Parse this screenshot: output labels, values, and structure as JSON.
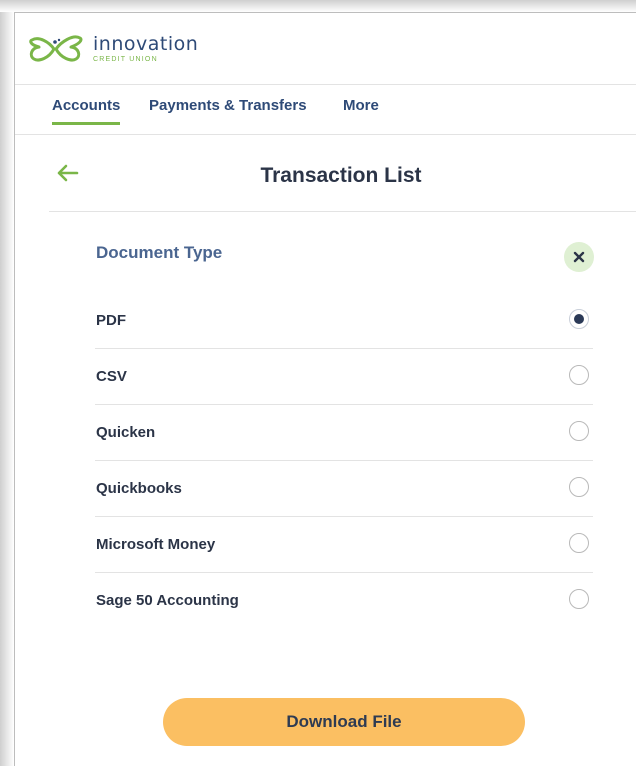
{
  "brand": {
    "name": "innovation",
    "subtitle": "CREDIT UNION",
    "primary_color": "#2e4a77",
    "accent_color": "#7ab648"
  },
  "nav": {
    "items": [
      {
        "label": "Accounts",
        "active": true
      },
      {
        "label": "Payments & Transfers",
        "active": false
      },
      {
        "label": "More",
        "active": false
      }
    ]
  },
  "header": {
    "title": "Transaction List",
    "back_icon": "arrow-left-icon"
  },
  "document_type": {
    "title": "Document Type",
    "close_icon": "close-icon",
    "selected": "PDF",
    "options": [
      {
        "label": "PDF",
        "selected": true
      },
      {
        "label": "CSV",
        "selected": false
      },
      {
        "label": "Quicken",
        "selected": false
      },
      {
        "label": "Quickbooks",
        "selected": false
      },
      {
        "label": "Microsoft Money",
        "selected": false
      },
      {
        "label": "Sage 50 Accounting",
        "selected": false
      }
    ]
  },
  "actions": {
    "download_label": "Download File",
    "download_color": "#fbbf62"
  }
}
